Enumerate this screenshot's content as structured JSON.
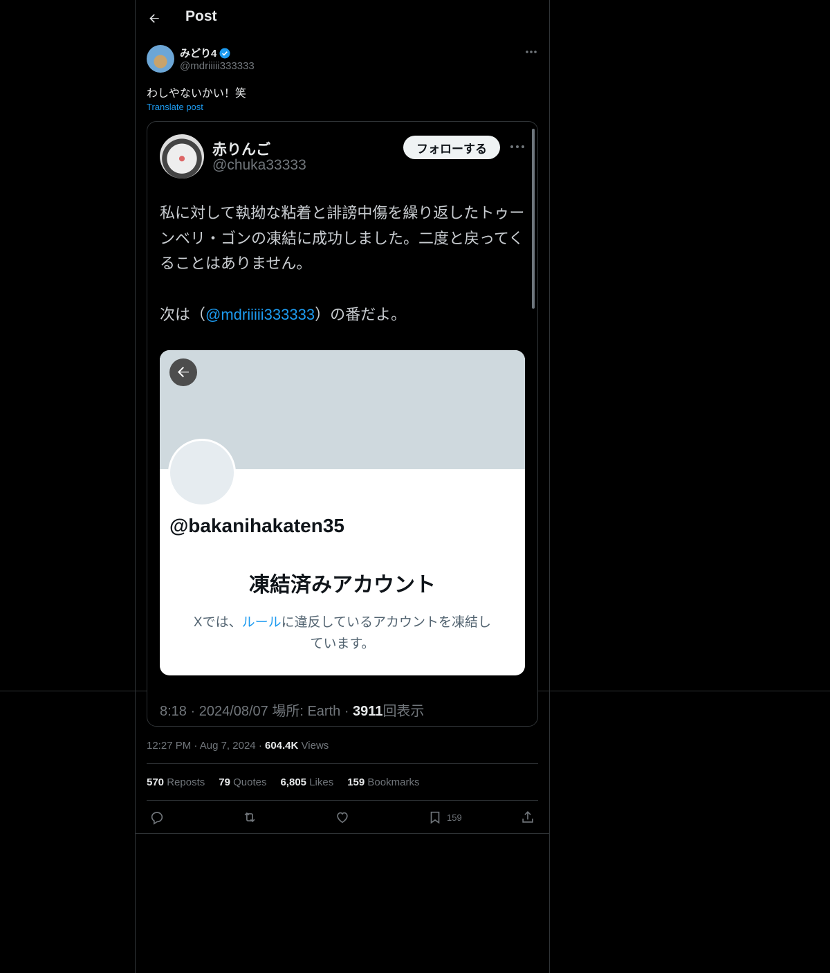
{
  "header": {
    "title": "Post"
  },
  "post": {
    "display_name": "みどり4",
    "handle": "@mdriiiii333333",
    "text": "わしやないかい！笑",
    "translate": "Translate post",
    "time": "12:27 PM",
    "date": "Aug 7, 2024",
    "views_count": "604.4K",
    "views_label": "Views",
    "sep": "·"
  },
  "embedded_screenshot": {
    "display_name": "赤りんご",
    "handle": "@chuka33333",
    "follow_label": "フォローする",
    "body": "私に対して執拗な粘着と誹謗中傷を繰り返したトゥーンベリ・ゴンの凍結に成功しました。二度と戻ってくることはありません。",
    "mention_prefix": "次は（",
    "mention": "@mdriiiii333333",
    "mention_suffix": "）の番だよ。",
    "meta_prefix": "8:18 · 2024/08/07 場所: Earth · ",
    "meta_views": "3911",
    "meta_suffix": "回表示",
    "card": {
      "handle": "@bakanihakaten35",
      "title": "凍結済みアカウント",
      "desc_prefix": "Xでは、",
      "desc_link": "ルール",
      "desc_suffix": "に違反しているアカウントを凍結しています。"
    }
  },
  "stats": {
    "reposts_count": "570",
    "reposts_label": "Reposts",
    "quotes_count": "79",
    "quotes_label": "Quotes",
    "likes_count": "6,805",
    "likes_label": "Likes",
    "bookmarks_count": "159",
    "bookmarks_label": "Bookmarks"
  },
  "actions": {
    "icons": [
      "reply-icon",
      "repost-icon",
      "like-icon",
      "bookmark-icon",
      "share-icon"
    ],
    "bookmark_count": "159"
  },
  "colors": {
    "accent": "#1d9bf0",
    "verified": "#1d9bf0",
    "muted": "#71767b",
    "border": "#2f3336"
  }
}
